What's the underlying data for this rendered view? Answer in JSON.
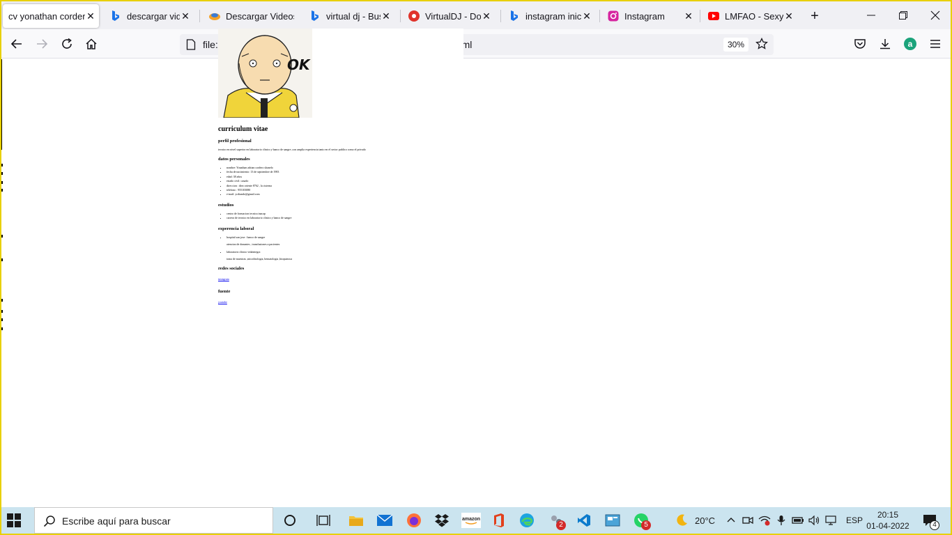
{
  "browser": {
    "tabs": [
      {
        "title": "cv yonathan cordero",
        "active": true,
        "favicon": "document-icon"
      },
      {
        "title": "descargar videos",
        "active": false,
        "favicon": "bing-icon"
      },
      {
        "title": "Descargar Videos",
        "active": false,
        "favicon": "colorful-app-icon"
      },
      {
        "title": "virtual dj - Buscar",
        "active": false,
        "favicon": "bing-icon"
      },
      {
        "title": "VirtualDJ - Download",
        "active": false,
        "favicon": "virtualdj-icon"
      },
      {
        "title": "instagram iniciar",
        "active": false,
        "favicon": "bing-icon"
      },
      {
        "title": "Instagram",
        "active": false,
        "favicon": "instagram-icon"
      },
      {
        "title": "LMFAO - Sexy and",
        "active": false,
        "favicon": "youtube-icon"
      }
    ],
    "url": "file:///C:/Users/... .html",
    "url_start": "file:/",
    "url_end": ":ml",
    "zoom": "30%"
  },
  "page": {
    "photo_label": "OK",
    "title": "curriculum vitae",
    "perfil_heading": "perfil profesional",
    "perfil_text": "tecnico en nivel superior en laboratorio clinico y banco de sangre ,con amplia experiencia tanto en el sector publico como el privado",
    "datos_heading": "datos personales",
    "datos_items": [
      "nombre: Yonathan adrian cordero shanelo",
      "fecha de nacimiento: 13 de septiembre de 1983",
      "edad: 38 años",
      "estado civil: casado",
      "direccion : diez oriente 8762 , la cisterna",
      "telefono : 955103080",
      "e-mail: ycdtando@gmail.com"
    ],
    "estudios_heading": "estudios",
    "estudios_items": [
      "centro de formacion tecnica inacap",
      "carrera de tecnico en laboratorio clinico y banco de sangre"
    ],
    "experiencia_heading": "experencia laboral",
    "experiencia_items": [
      {
        "place": "hospital san jose : banco de sangre",
        "desc": "atencion de donantes , transfusiones a pacientes"
      },
      {
        "place": "laboratorio clinico vidaintegra",
        "desc": "toma de muestras ,microbiologia, hematologia ,bioquimica"
      }
    ],
    "redes_heading": "redes sociales",
    "redes_link": "instagram",
    "fuente_heading": "fuente",
    "fuente_link": "youtube"
  },
  "taskbar": {
    "search_placeholder": "Escribe aquí para buscar",
    "temperature": "20°C",
    "language": "ESP",
    "time": "20:15",
    "date": "01-04-2022",
    "badges": {
      "teams": "2",
      "whatsapp": "5",
      "notifications": "4"
    }
  },
  "colors": {
    "frame": "#e8d000",
    "tabbar": "#f0f0f4",
    "taskbar": "#cbe4ef",
    "link": "#0000ee"
  }
}
